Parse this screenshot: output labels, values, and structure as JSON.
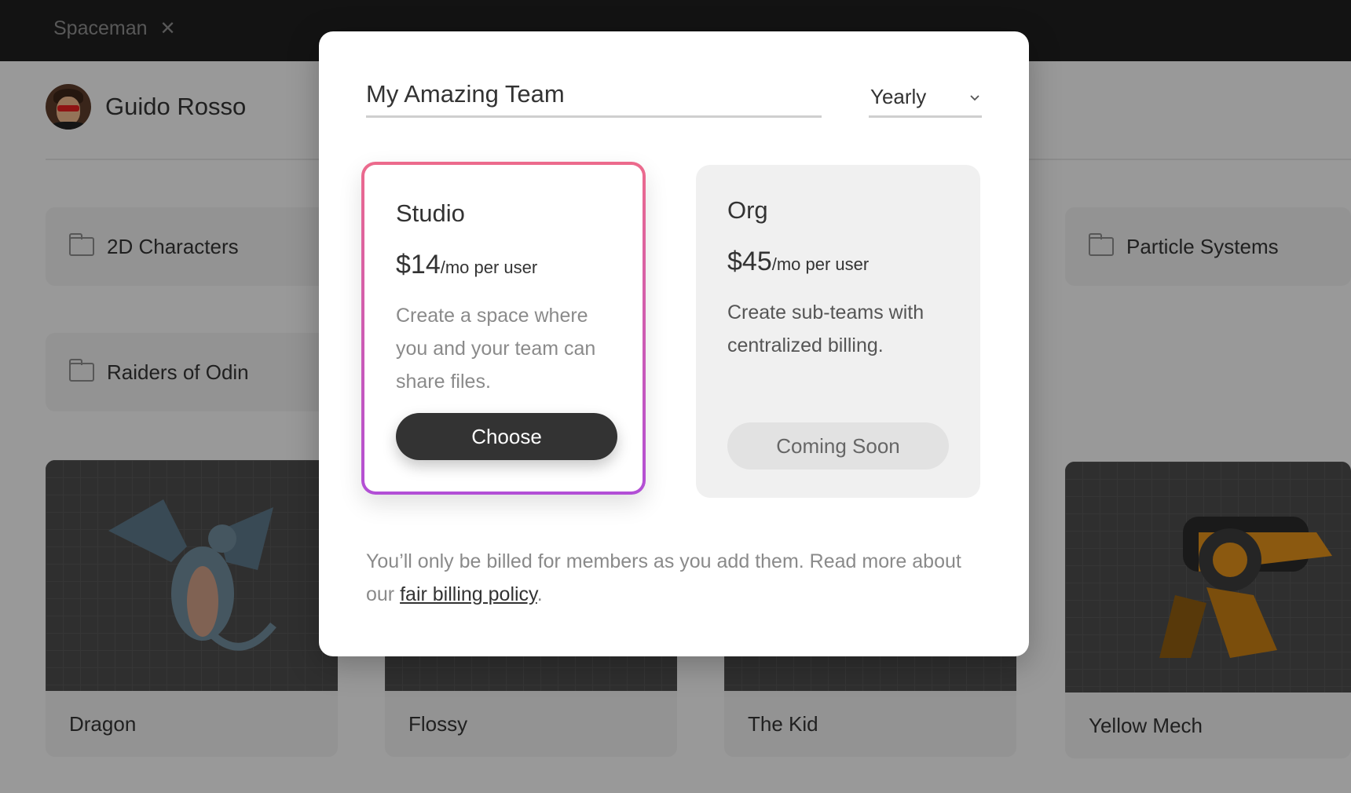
{
  "tab": {
    "title": "Spaceman",
    "close_glyph": "✕"
  },
  "profile": {
    "name": "Guido Rosso"
  },
  "folders": [
    {
      "name": "2D Characters"
    },
    {
      "name": "Particle Systems"
    },
    {
      "name": "Raiders of Odin"
    }
  ],
  "assets": [
    {
      "name": "Dragon"
    },
    {
      "name": "Flossy"
    },
    {
      "name": "The Kid"
    },
    {
      "name": "Yellow Mech"
    }
  ],
  "modal": {
    "team_name": "My Amazing Team",
    "period": {
      "selected": "Yearly"
    },
    "plans": [
      {
        "name": "Studio",
        "price": "$14",
        "unit": "/mo per user",
        "description": "Create a space where you and your team can share files.",
        "button": "Choose"
      },
      {
        "name": "Org",
        "price": "$45",
        "unit": "/mo per user",
        "description": "Create sub-teams with centralized billing.",
        "button": "Coming Soon"
      }
    ],
    "billing_note": {
      "text": "You’ll only be billed for members as you add them. Read more about our ",
      "link": "fair billing policy",
      "end": "."
    }
  },
  "colors": {
    "topbar": "#1e1e1e",
    "studio_border_top": "#ec6a8c",
    "studio_border_bottom": "#b24fd6",
    "primary_button": "#333333"
  }
}
